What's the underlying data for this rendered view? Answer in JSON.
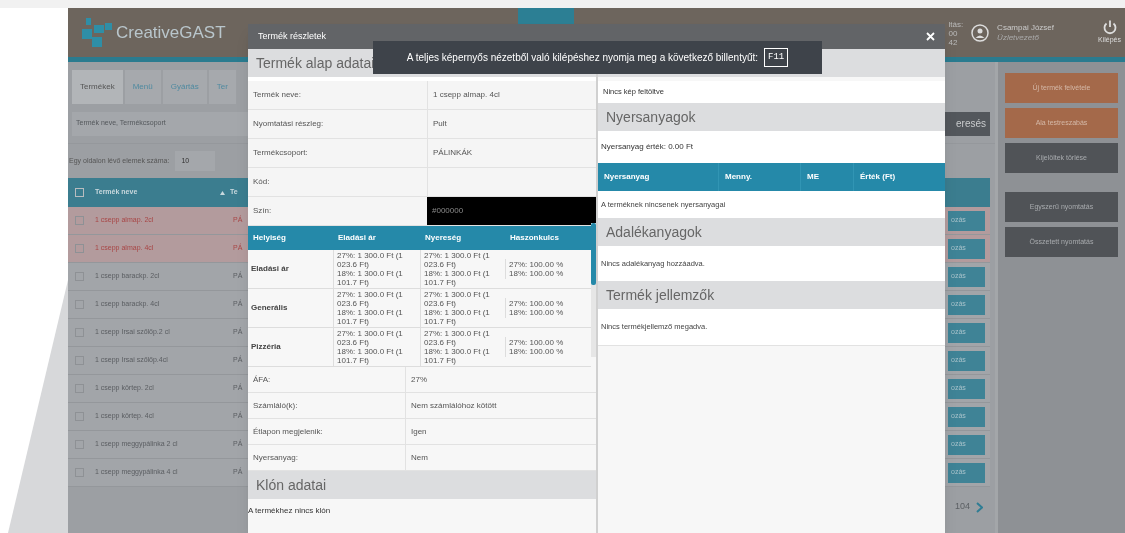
{
  "header": {
    "logo": "CreativeGAST",
    "info_fragments": [
      "ltás:",
      "00",
      "42"
    ],
    "user": {
      "name": "Csampai József",
      "role": "Üzletvezető"
    },
    "logout": "Kilépés"
  },
  "tabs": [
    {
      "label": "Termékek",
      "selected": true
    },
    {
      "label": "Menü",
      "selected": false
    },
    {
      "label": "Gyártás",
      "selected": false
    },
    {
      "label": "Ter",
      "selected": false
    }
  ],
  "search": {
    "placeholder": "Termék neve, Termékcsoport",
    "button": "eresés"
  },
  "page_size": {
    "label": "Egy oldalon lévő elemek száma:",
    "value": "10"
  },
  "table": {
    "select_all": {
      "checked": false
    },
    "columns": [
      "Termék neve",
      "Te"
    ],
    "rows": [
      {
        "name": "1 csepp almap. 2cl",
        "group": "PÁ",
        "action": "ozás",
        "highlighted": true
      },
      {
        "name": "1 csepp almap. 4cl",
        "group": "PÁ",
        "action": "ozás",
        "highlighted": true
      },
      {
        "name": "1 csepp barackp. 2cl",
        "group": "PÁ",
        "action": "ozás",
        "highlighted": false
      },
      {
        "name": "1 csepp barackp. 4cl",
        "group": "PÁ",
        "action": "ozás",
        "highlighted": false
      },
      {
        "name": "1 csepp Irsai szőlőp.2 cl",
        "group": "PÁ",
        "action": "ozás",
        "highlighted": false
      },
      {
        "name": "1 csepp Irsai szőlőp.4cl",
        "group": "PÁ",
        "action": "ozás",
        "highlighted": false
      },
      {
        "name": "1 csepp körtep. 2cl",
        "group": "PÁ",
        "action": "ozás",
        "highlighted": false
      },
      {
        "name": "1 csepp körtep. 4cl",
        "group": "PÁ",
        "action": "ozás",
        "highlighted": false
      },
      {
        "name": "1 csepp meggypálinka 2 cl",
        "group": "PÁ",
        "action": "ozás",
        "highlighted": false
      },
      {
        "name": "1 csepp meggypálinka 4 cl",
        "group": "PÁ",
        "action": "ozás",
        "highlighted": false
      }
    ]
  },
  "pagination": {
    "last": "104"
  },
  "sidebar": [
    {
      "label": "Új termék felvétele",
      "kind": "primary"
    },
    {
      "label": "Ala testreszabás",
      "kind": "primary"
    },
    {
      "label": "Kijelöltek törlése",
      "kind": "secondary"
    },
    {
      "label": "Egyszerű nyomtatás",
      "kind": "secondary"
    },
    {
      "label": "Összetett nyomtatás",
      "kind": "secondary"
    }
  ],
  "modal": {
    "title": "Termék részletek",
    "toast": {
      "text": "A teljes képernyős nézetből való kilépéshez nyomja meg a következő billentyűt:",
      "key": "F11"
    },
    "basic": {
      "title": "Termék alap adatai",
      "rows": [
        {
          "label": "Termék neve:",
          "value": "1 csepp almap. 4cl",
          "kind": "text"
        },
        {
          "label": "Nyomtatási részleg:",
          "value": "Pult",
          "kind": "text"
        },
        {
          "label": "Termékcsoport:",
          "value": "PÁLINKÁK",
          "kind": "text"
        },
        {
          "label": "Kód:",
          "value": "",
          "kind": "text"
        },
        {
          "label": "Szín:",
          "value": "#000000",
          "kind": "color"
        }
      ]
    },
    "prices": {
      "columns": [
        "Helyiség",
        "Eladási ár",
        "Nyereség",
        "Haszonkulcs"
      ],
      "rows": [
        {
          "place": "Eladási ár",
          "price": [
            "27%: 1 300.0 Ft (1 023.6 Ft)",
            "18%: 1 300.0 Ft (1 101.7 Ft)"
          ],
          "profit": [
            "27%: 1 300.0 Ft (1 023.6 Ft)",
            "18%: 1 300.0 Ft (1 101.7 Ft)"
          ],
          "margin": [
            "27%: 100.00 %",
            "18%: 100.00 %"
          ]
        },
        {
          "place": "Generális",
          "price": [
            "27%: 1 300.0 Ft (1 023.6 Ft)",
            "18%: 1 300.0 Ft (1 101.7 Ft)"
          ],
          "profit": [
            "27%: 1 300.0 Ft (1 023.6 Ft)",
            "18%: 1 300.0 Ft (1 101.7 Ft)"
          ],
          "margin": [
            "27%: 100.00 %",
            "18%: 100.00 %"
          ]
        },
        {
          "place": "Pizzéria",
          "price": [
            "27%: 1 300.0 Ft (1 023.6 Ft)",
            "18%: 1 300.0 Ft (1 101.7 Ft)"
          ],
          "profit": [
            "27%: 1 300.0 Ft (1 023.6 Ft)",
            "18%: 1 300.0 Ft (1 101.7 Ft)"
          ],
          "margin": [
            "27%: 100.00 %",
            "18%: 100.00 %"
          ]
        }
      ]
    },
    "details": [
      {
        "label": "ÁFA:",
        "value": "27%"
      },
      {
        "label": "Számláló(k):",
        "value": "Nem számlálóhoz kötött"
      },
      {
        "label": "Étlapon megjelenik:",
        "value": "Igen"
      },
      {
        "label": "Nyersanyag:",
        "value": "Nem"
      }
    ],
    "clone": {
      "title": "Klón adatai",
      "text": "A termékhez nincs klón"
    },
    "image": {
      "text": "Nincs kép feltöltve"
    },
    "materials": {
      "title": "Nyersanyagok",
      "value": "Nyersanyag érték: 0.00 Ft",
      "columns": [
        "Nyersanyag",
        "Menny.",
        "ME",
        "Érték (Ft)"
      ],
      "empty": "A terméknek nincsenek nyersanyagai"
    },
    "additives": {
      "title": "Adalékanyagok",
      "empty": "Nincs adalékanyag hozzáadva."
    },
    "features": {
      "title": "Termék jellemzők",
      "empty": "Nincs termékjellemző megadva."
    }
  }
}
